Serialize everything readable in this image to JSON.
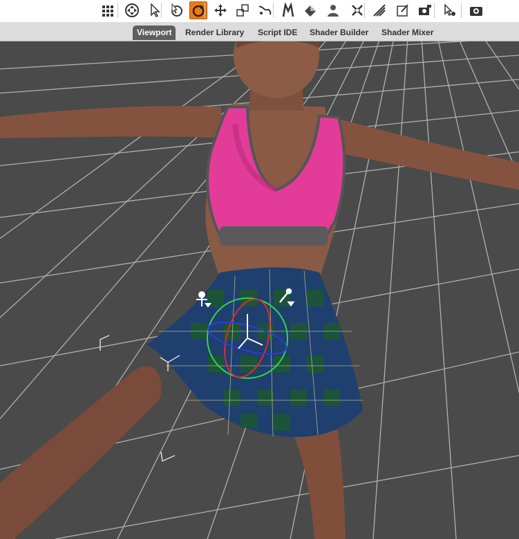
{
  "toolbar": {
    "tools": [
      {
        "name": "node-selection-icon",
        "active": false
      },
      {
        "name": "universal-tool-icon",
        "active": false
      },
      {
        "name": "surface-selection-icon",
        "active": false
      },
      {
        "name": "rotate-tool-icon",
        "active": false
      },
      {
        "name": "twist-tool-icon",
        "active": true
      },
      {
        "name": "translate-tool-icon",
        "active": false
      },
      {
        "name": "scale-tool-icon",
        "active": false
      },
      {
        "name": "joint-editor-icon",
        "active": false
      },
      {
        "name": "active-pose-icon",
        "active": false
      },
      {
        "name": "geometry-editor-icon",
        "active": false
      },
      {
        "name": "figure-setup-icon",
        "active": false
      },
      {
        "name": "transfer-utility-icon",
        "active": false
      },
      {
        "name": "spot-render-icon",
        "active": false
      },
      {
        "name": "region-navigator-icon",
        "active": false
      },
      {
        "name": "camera-render-icon",
        "active": false
      },
      {
        "name": "scene-settings-icon",
        "active": false
      },
      {
        "name": "render-icon",
        "active": false
      }
    ]
  },
  "tabs": [
    {
      "label": "Viewport",
      "active": true
    },
    {
      "label": "Render Library",
      "active": false
    },
    {
      "label": "Script IDE",
      "active": false
    },
    {
      "label": "Shader Builder",
      "active": false
    },
    {
      "label": "Shader Mixer",
      "active": false
    }
  ],
  "viewport": {
    "background_color": "#4a4a4a",
    "grid_color": "#bfbfbf",
    "skin_color": "#8a5a45",
    "top_color": "#e8389a",
    "skirt_color": "#1f3f6e",
    "skirt_check_color": "#1c5a2c"
  }
}
